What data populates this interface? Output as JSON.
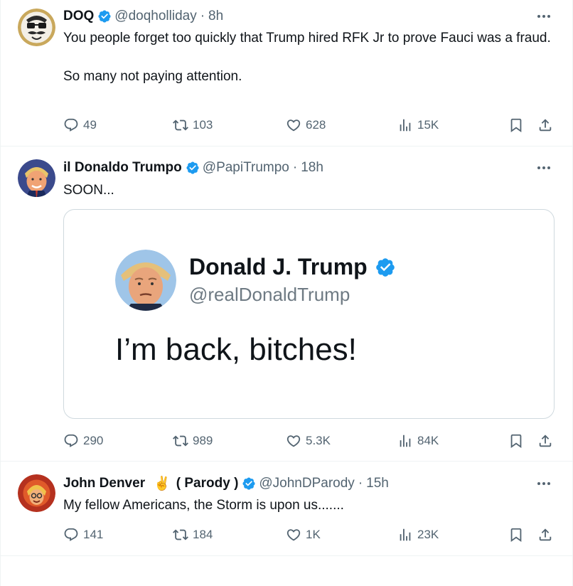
{
  "colors": {
    "accent": "#1d9bf0",
    "text_primary": "#0f1419",
    "text_secondary": "#536471",
    "border": "#eff3f4"
  },
  "tweets": [
    {
      "display_name": "DOQ",
      "handle": "@doqholliday",
      "separator": "·",
      "time": "8h",
      "text": "You people forget too quickly that Trump hired RFK Jr to prove Fauci was a fraud.\n\nSo many not paying attention.",
      "replies": "49",
      "retweets": "103",
      "likes": "628",
      "views": "15K"
    },
    {
      "display_name": "il Donaldo Trumpo",
      "handle": "@PapiTrumpo",
      "separator": "·",
      "time": "18h",
      "text": "SOON...",
      "embed": {
        "name": "Donald J. Trump",
        "handle": "@realDonaldTrump",
        "text": "I’m back, bitches!"
      },
      "replies": "290",
      "retweets": "989",
      "likes": "5.3K",
      "views": "84K"
    },
    {
      "display_name": "John Denver",
      "emoji": "✌️",
      "name_suffix": "( Parody )",
      "handle": "@JohnDParody",
      "separator": "·",
      "time": "15h",
      "text": "My fellow Americans, the Storm is upon us.......",
      "replies": "141",
      "retweets": "184",
      "likes": "1K",
      "views": "23K"
    }
  ]
}
